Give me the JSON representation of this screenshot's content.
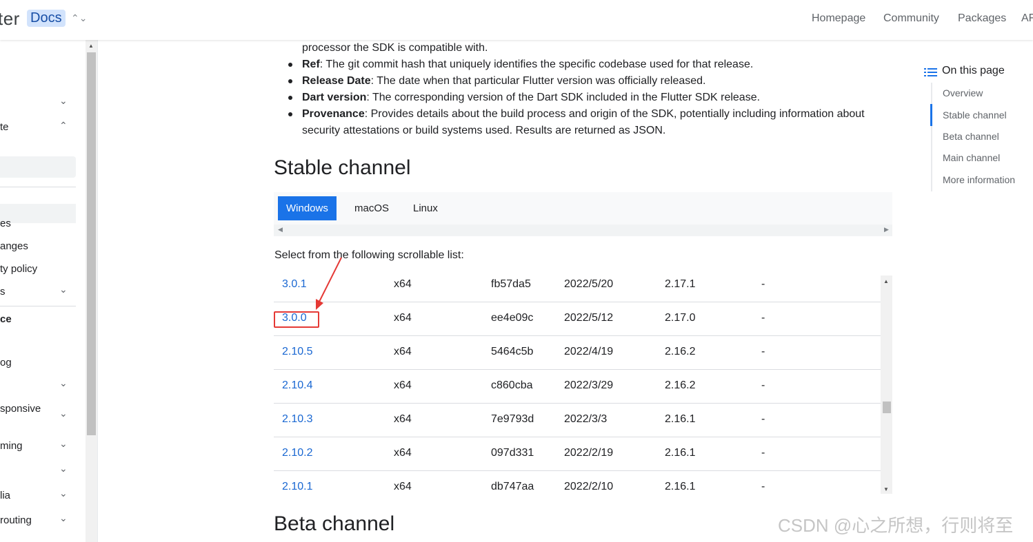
{
  "header": {
    "brand_partial": "ter",
    "docs_badge": "Docs",
    "switcher": "⌃⌄",
    "nav": [
      "Homepage",
      "Community",
      "Packages",
      "AF"
    ]
  },
  "sidebar": {
    "items": [
      {
        "label": "te",
        "chevron": "⌃"
      },
      {
        "label": "",
        "chevron": "⌄"
      },
      {
        "label": "es"
      },
      {
        "label": "anges"
      },
      {
        "label": "ty policy"
      },
      {
        "label": "s",
        "chevron": "⌄"
      },
      {
        "label": "ce"
      },
      {
        "label": "og"
      },
      {
        "label": "",
        "chevron": "⌄"
      },
      {
        "label": "sponsive",
        "chevron": "⌄"
      },
      {
        "label": "ming",
        "chevron": "⌄"
      },
      {
        "label": "",
        "chevron": "⌄"
      },
      {
        "label": "lia",
        "chevron": "⌄"
      },
      {
        "label": "routing",
        "chevron": "⌄"
      }
    ]
  },
  "content": {
    "bullets": [
      {
        "bold": "",
        "text": "processor the SDK is compatible with."
      },
      {
        "bold": "Ref",
        "text": ": The git commit hash that uniquely identifies the specific codebase used for that release."
      },
      {
        "bold": "Release Date",
        "text": ": The date when that particular Flutter version was officially released."
      },
      {
        "bold": "Dart version",
        "text": ": The corresponding version of the Dart SDK included in the Flutter SDK release."
      },
      {
        "bold": "Provenance",
        "text": ": Provides details about the build process and origin of the SDK, potentially including information about"
      },
      {
        "bold": "",
        "text": "security attestations or build systems used. Results are returned as JSON."
      }
    ],
    "stable_heading": "Stable channel",
    "tabs": [
      "Windows",
      "macOS",
      "Linux"
    ],
    "active_tab": "Windows",
    "select_label": "Select from the following scrollable list:",
    "releases": [
      {
        "version": "3.0.1",
        "arch": "x64",
        "ref": "fb57da5",
        "date": "2022/5/20",
        "dart": "2.17.1",
        "provenance": "-"
      },
      {
        "version": "3.0.0",
        "arch": "x64",
        "ref": "ee4e09c",
        "date": "2022/5/12",
        "dart": "2.17.0",
        "provenance": "-"
      },
      {
        "version": "2.10.5",
        "arch": "x64",
        "ref": "5464c5b",
        "date": "2022/4/19",
        "dart": "2.16.2",
        "provenance": "-"
      },
      {
        "version": "2.10.4",
        "arch": "x64",
        "ref": "c860cba",
        "date": "2022/3/29",
        "dart": "2.16.2",
        "provenance": "-"
      },
      {
        "version": "2.10.3",
        "arch": "x64",
        "ref": "7e9793d",
        "date": "2022/3/3",
        "dart": "2.16.1",
        "provenance": "-"
      },
      {
        "version": "2.10.2",
        "arch": "x64",
        "ref": "097d331",
        "date": "2022/2/19",
        "dart": "2.16.1",
        "provenance": "-"
      },
      {
        "version": "2.10.1",
        "arch": "x64",
        "ref": "db747aa",
        "date": "2022/2/10",
        "dart": "2.16.1",
        "provenance": "-"
      }
    ],
    "beta_heading": "Beta channel"
  },
  "toc": {
    "title": "On this page",
    "items": [
      "Overview",
      "Stable channel",
      "Beta channel",
      "Main channel",
      "More information"
    ],
    "active": "Stable channel"
  },
  "watermark": "CSDN @心之所想，行则将至",
  "colors": {
    "accent": "#1a73e8",
    "link": "#1967d2",
    "annotation": "#e53935"
  }
}
